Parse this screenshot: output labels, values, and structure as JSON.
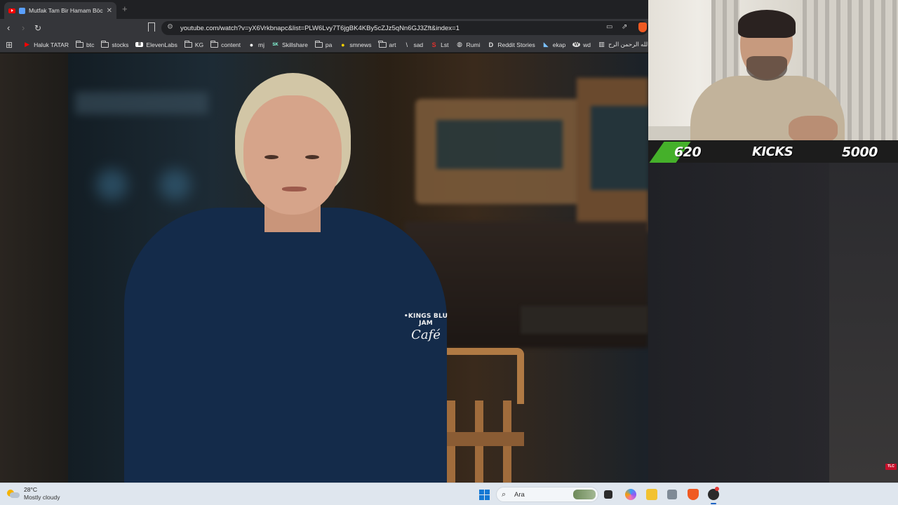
{
  "browser": {
    "tab": {
      "title": "Mutfak Tam Bir Hamam Böcek"
    },
    "new_tab_symbol": "+",
    "url": "youtube.com/watch?v=yX6Vrkbnapc&list=PLW6Lvy7T6jgBK4KBy5cZJz5qNn6GJ3Zft&index=1",
    "bookmarks": [
      {
        "label": "Haluk TATAR",
        "icon": "youtube-icon",
        "color": "#ff0000"
      },
      {
        "label": "btc",
        "icon": "folder-icon"
      },
      {
        "label": "stocks",
        "icon": "folder-icon"
      },
      {
        "label": "ElevenLabs",
        "icon": "elevenlabs-icon"
      },
      {
        "label": "KG",
        "icon": "folder-icon"
      },
      {
        "label": "content",
        "icon": "folder-icon"
      },
      {
        "label": "mj",
        "icon": "github-icon"
      },
      {
        "label": "Skillshare",
        "icon": "skillshare-icon"
      },
      {
        "label": "pa",
        "icon": "folder-icon"
      },
      {
        "label": "smnews",
        "icon": "smiley-icon"
      },
      {
        "label": "art",
        "icon": "folder-icon"
      },
      {
        "label": "sad",
        "icon": "feather-icon"
      },
      {
        "label": "Lst",
        "icon": "s-logo-icon",
        "color": "#e0312d"
      },
      {
        "label": "Rumi",
        "icon": "globe-icon"
      },
      {
        "label": "Reddit Stories",
        "icon": "d-logo-icon"
      },
      {
        "label": "ekap",
        "icon": "bird-icon"
      },
      {
        "label": "wd",
        "icon": "wikipedia-icon"
      },
      {
        "label": "الله الرحمن الرح...",
        "icon": "book-icon"
      }
    ]
  },
  "video": {
    "shirt_logo_line1": "•KINGS BLU JAM",
    "shirt_logo_line2": "Café",
    "channel_badge": "TLC"
  },
  "overlay": {
    "current": "620",
    "label": "KICKS",
    "goal": "5000",
    "accent_color": "#45b02a"
  },
  "taskbar": {
    "weather_temp": "28°C",
    "weather_desc": "Mostly cloudy",
    "search_placeholder": "Ara"
  }
}
